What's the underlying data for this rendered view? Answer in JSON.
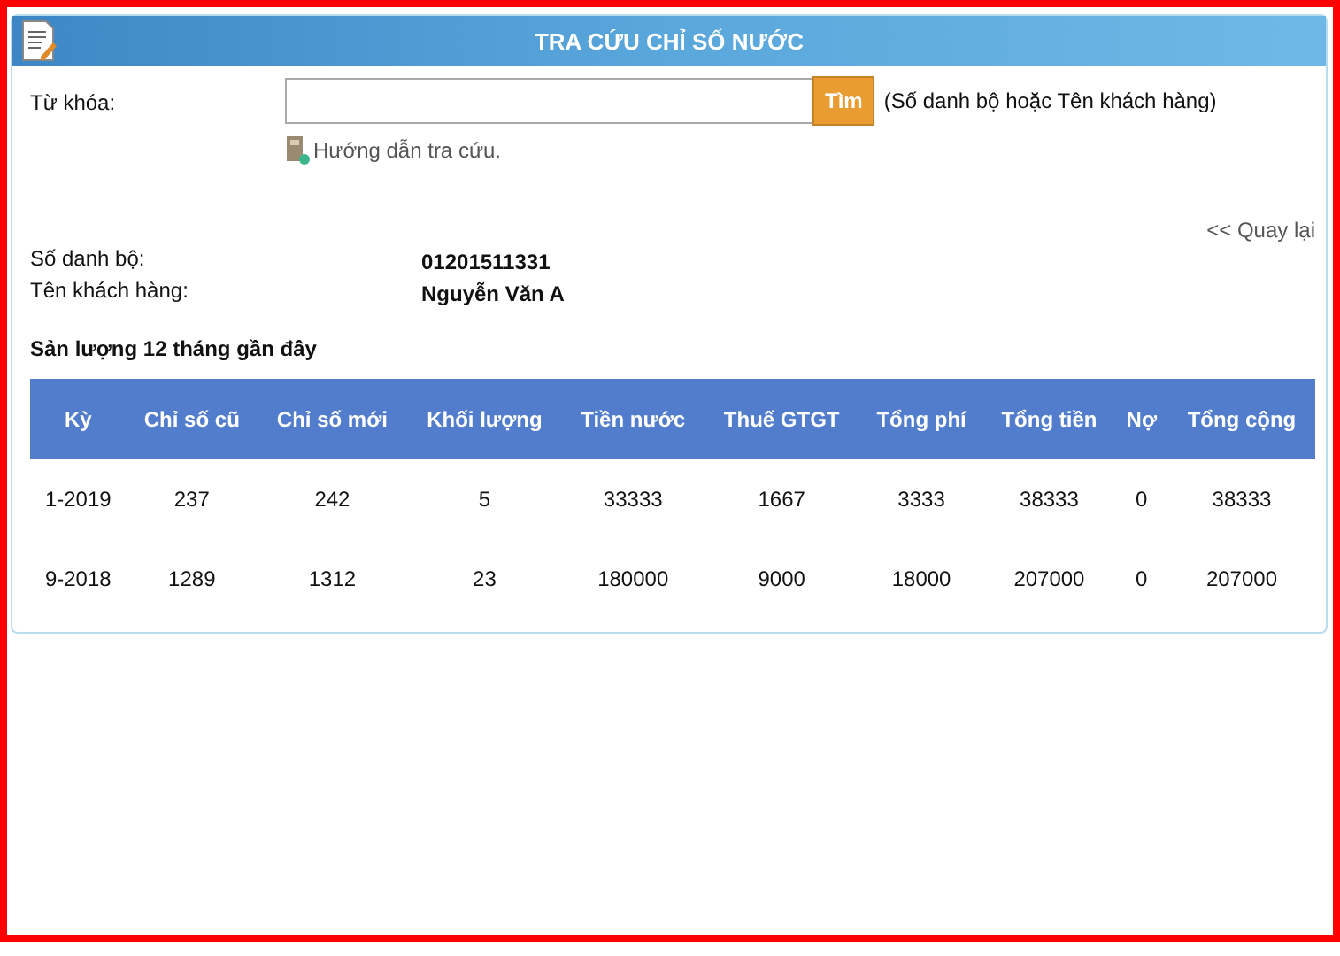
{
  "header": {
    "title": "TRA CỨU CHỈ SỐ NƯỚC"
  },
  "search": {
    "label": "Từ khóa:",
    "button": "Tìm",
    "hint": "(Số danh bộ hoặc Tên khách hàng)",
    "guide_link": "Hướng dẫn tra cứu."
  },
  "back_link": "<< Quay lại",
  "customer": [
    {
      "label": "Số danh bộ:",
      "value": "01201511331"
    },
    {
      "label": "Tên khách hàng:",
      "value": "Nguyễn Văn A"
    }
  ],
  "section_title": "Sản lượng 12 tháng gần đây",
  "table": {
    "columns": [
      "Kỳ",
      "Chỉ số cũ",
      "Chỉ số mới",
      "Khối lượng",
      "Tiền nước",
      "Thuế GTGT",
      "Tổng phí",
      "Tổng tiền",
      "Nợ",
      "Tổng cộng"
    ],
    "rows": [
      [
        "1-2019",
        "237",
        "242",
        "5",
        "33333",
        "1667",
        "3333",
        "38333",
        "0",
        "38333"
      ],
      [
        "9-2018",
        "1289",
        "1312",
        "23",
        "180000",
        "9000",
        "18000",
        "207000",
        "0",
        "207000"
      ]
    ]
  }
}
